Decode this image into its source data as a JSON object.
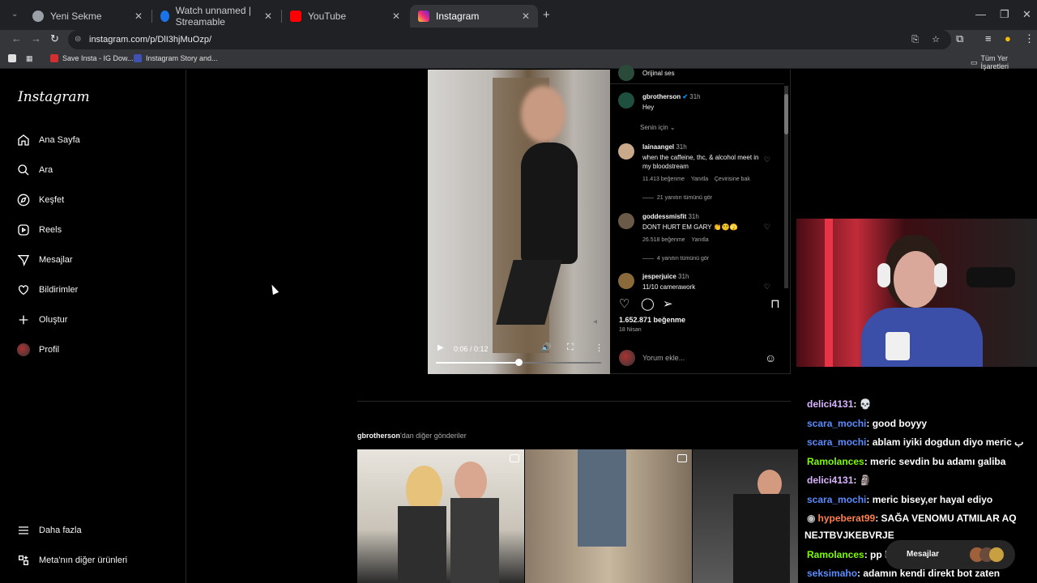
{
  "browser": {
    "tabs": [
      {
        "title": "Yeni Sekme",
        "favicon_color": "#9aa0a6"
      },
      {
        "title": "Watch unnamed | Streamable",
        "favicon_color": "#1a73e8"
      },
      {
        "title": "YouTube",
        "favicon_color": "#ff0000"
      },
      {
        "title": "Instagram",
        "favicon_color": "#e1306c"
      }
    ],
    "url": "instagram.com/p/DlI3hjMuOzp/",
    "bookmarks": [
      {
        "label": "Save Insta - IG Dow...",
        "color": "#d32f2f"
      },
      {
        "label": "Instagram Story and...",
        "color": "#3f51b5"
      }
    ],
    "all_bookmarks_label": "Tüm Yer İşaretleri"
  },
  "sidebar": {
    "logo": "Instagram",
    "items": [
      {
        "label": "Ana Sayfa",
        "icon": "home-icon"
      },
      {
        "label": "Ara",
        "icon": "search-icon"
      },
      {
        "label": "Keşfet",
        "icon": "compass-icon"
      },
      {
        "label": "Reels",
        "icon": "reels-icon"
      },
      {
        "label": "Mesajlar",
        "icon": "send-icon"
      },
      {
        "label": "Bildirimler",
        "icon": "heart-icon"
      },
      {
        "label": "Oluştur",
        "icon": "plus-icon"
      },
      {
        "label": "Profil",
        "icon": "avatar-icon"
      }
    ],
    "more": "Daha fazla",
    "meta": "Meta'nın diğer ürünleri"
  },
  "post": {
    "audio": "Orijinal ses",
    "video_time": "0:06 / 0:12",
    "progress": 0.5,
    "author": "gbrotherson",
    "author_time": "31h",
    "caption": "Hey",
    "sort_label": "Senin için",
    "comments": [
      {
        "user": "lainaangel",
        "time": "31h",
        "text": "when the caffeine, thc, & alcohol meet in my bloodstream",
        "likes": "11.413 beğenme",
        "reply": "Yanıtla",
        "translate": "Çevirisine bak",
        "replies": "21 yanıtın tümünü gör"
      },
      {
        "user": "goddessmisfit",
        "time": "31h",
        "text": "DONT HURT EM GARY 👏😵‍💫🫣",
        "likes": "26.518 beğenme",
        "reply": "Yanıtla",
        "replies": "4 yanıtın tümünü gör"
      },
      {
        "user": "jesperjuice",
        "time": "31h",
        "text": "11/10 camerawork"
      }
    ],
    "like_count": "1.652.871 beğenme",
    "date": "18 Nisan",
    "comment_placeholder": "Yorum ekle...",
    "more_from_user": "gbrotherson",
    "more_from_suffix": "'dan diğer gönderiler"
  },
  "chat": [
    {
      "user": "delici4131",
      "color": "#d8b4fe",
      "text": ": 💀"
    },
    {
      "user": "scara_mochi",
      "color": "#5b8cff",
      "text": ": good boyyy"
    },
    {
      "user": "scara_mochi",
      "color": "#5b8cff",
      "text": ": ablam iyiki dogdun diyo meric ب"
    },
    {
      "user": "Ramolances",
      "color": "#7cfc00",
      "text": ": meric sevdin bu adamı galiba"
    },
    {
      "user": "delici4131",
      "color": "#d8b4fe",
      "text": ": 🗿"
    },
    {
      "user": "scara_mochi",
      "color": "#5b8cff",
      "text": ": meric bisey,er hayal ediyo"
    },
    {
      "user": "hypeberat99",
      "color": "#ff7f50",
      "text": ": SAĞA VENOMU ATMILAR AQ"
    },
    {
      "user": "",
      "color": "#ffffff",
      "text": "NEJTBVJKEBVRJE"
    },
    {
      "user": "Ramolances",
      "color": "#7cfc00",
      "text": ": pp bak"
    },
    {
      "user": "seksimaho",
      "color": "#5b8cff",
      "text": ": adamın kendi direkt bot zaten"
    }
  ],
  "messages_label": "Mesajlar"
}
